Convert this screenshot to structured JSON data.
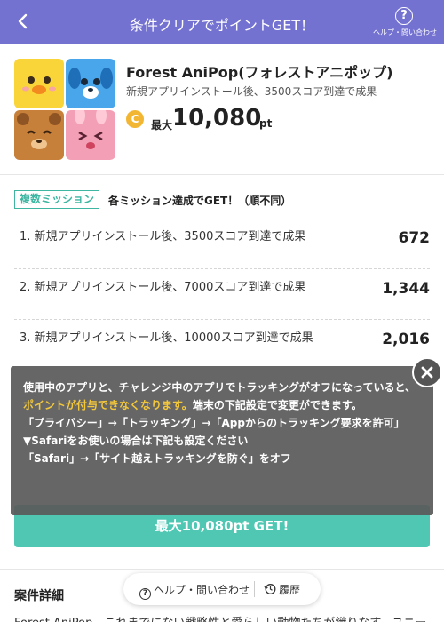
{
  "header": {
    "title": "条件クリアでポイントGET！",
    "help_label": "ヘルプ・問い合わせ",
    "help_glyph": "?"
  },
  "app": {
    "name": "Forest AniPop(フォレストアニポップ)",
    "subtitle": "新規アプリインストール後、3500スコア到達で成果",
    "coin_glyph": "C",
    "points_prefix": "最大",
    "points_value": "10,080",
    "points_unit": "pt",
    "icon_colors": [
      "#f9d53a",
      "#4aa6ea",
      "#c7803a",
      "#f3a0b6"
    ]
  },
  "missions": {
    "badge": "複数ミッション",
    "heading": "各ミッション達成でGET！（順不同）",
    "items": [
      {
        "text": "1. 新規アプリインストール後、3500スコア到達で成果",
        "value": "672"
      },
      {
        "text": "2. 新規アプリインストール後、7000スコア到達で成果",
        "value": "1,344"
      },
      {
        "text": "3. 新規アプリインストール後、10000スコア到達で成果",
        "value": "2,016"
      }
    ]
  },
  "overlay": {
    "line1_pre": "使用中のアプリと、チャレンジ中のアプリでトラッキングがオフになっていると、",
    "line1_highlight": "ポイントが付与できなくなります。",
    "line1_post": "端末の下記設定で変更ができます。",
    "line2": "「プライバシー」→「トラッキング」→「Appからのトラッキング要求を許可」",
    "line3": "▼Safariをお使いの場合は下記も設定ください",
    "line4": "「Safari」→「サイト越えトラッキングを防ぐ」をオフ",
    "highlight_color": "#f4c83b"
  },
  "cta": {
    "label": "最大10,080pt GET!"
  },
  "detail": {
    "title": "案件詳細",
    "body": "Forest AniPop、これまでにない戦略性と愛らしい動物たちが織りなす、ユニー"
  },
  "bottom_bar": {
    "help_label": "ヘルプ・問い合わせ",
    "history_label": "履歴"
  },
  "colors": {
    "header": "#7472d1",
    "accent": "#4fc7b3",
    "badge": "#3fb6a2",
    "coin": "#f2b632"
  }
}
